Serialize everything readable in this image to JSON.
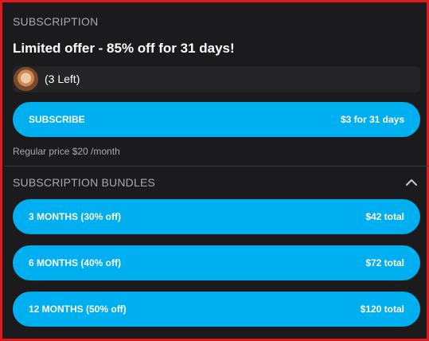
{
  "subscription": {
    "heading": "SUBSCRIPTION",
    "offer_title": "Limited offer - 85% off for 31 days!",
    "remaining": "(3 Left)",
    "subscribe_label": "SUBSCRIBE",
    "subscribe_price": "$3 for 31 days",
    "regular_price": "Regular price $20 /month"
  },
  "bundles": {
    "heading": "SUBSCRIPTION BUNDLES",
    "toggle_icon": "chevron-up-icon",
    "items": [
      {
        "label": "3 MONTHS (30% off)",
        "price": "$42 total"
      },
      {
        "label": "6 MONTHS (40% off)",
        "price": "$72 total"
      },
      {
        "label": "12 MONTHS (50% off)",
        "price": "$120 total"
      }
    ]
  },
  "colors": {
    "accent": "#00aff0",
    "background": "#1b1b1d",
    "border": "#e3181d",
    "muted_text": "#a9a9ad"
  }
}
